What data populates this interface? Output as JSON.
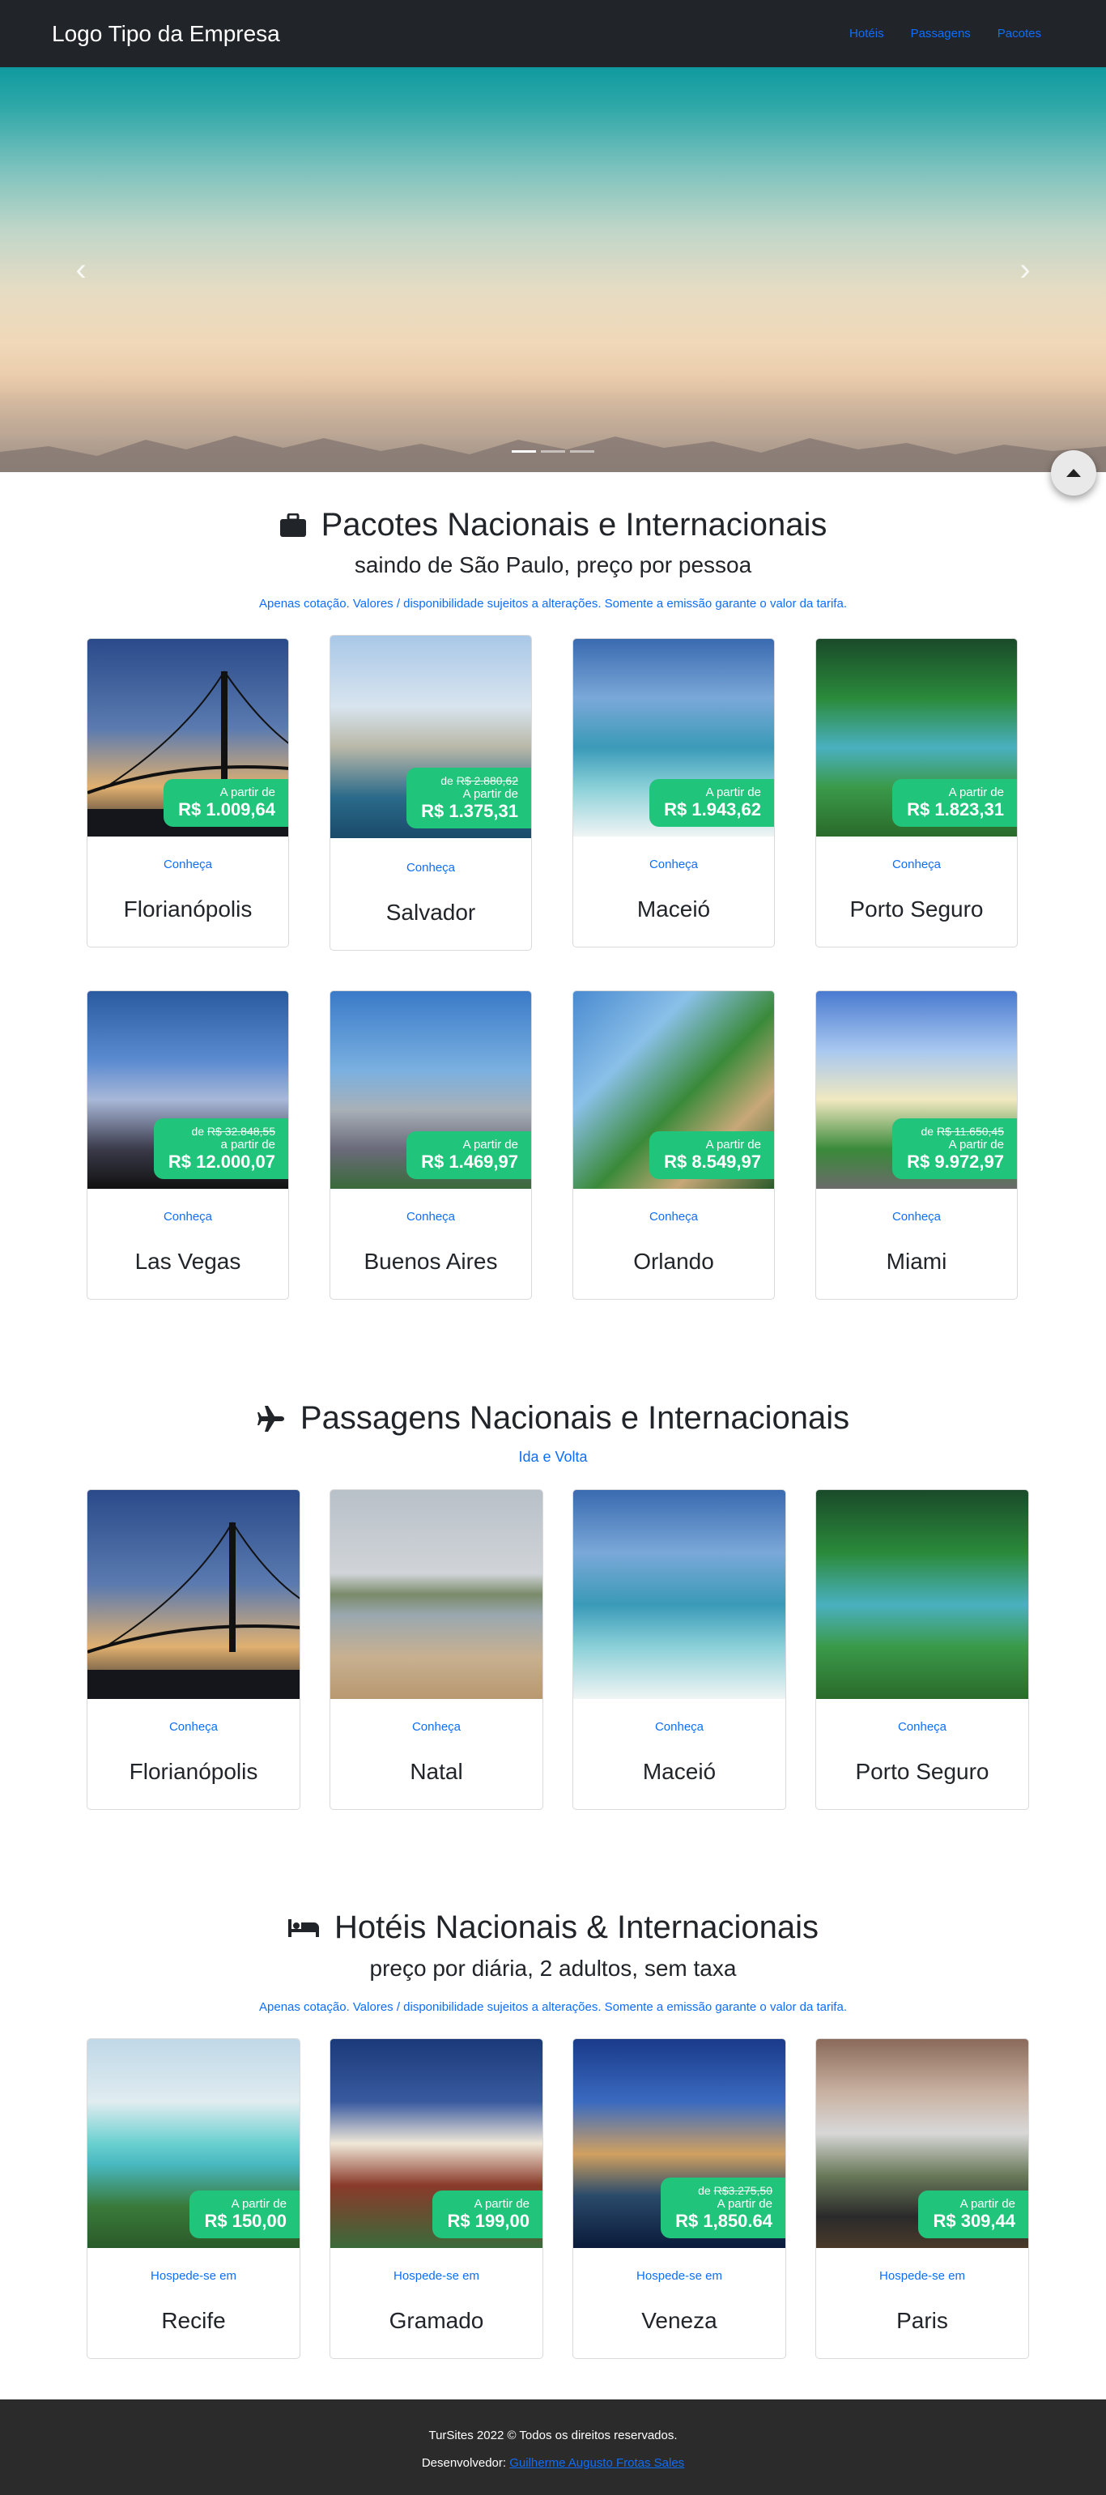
{
  "navbar": {
    "brand": "Logo Tipo da Empresa",
    "links": [
      "Hotéis",
      "Passagens",
      "Pacotes"
    ]
  },
  "carousel": {
    "prev": "‹",
    "next": "›",
    "slides": 3,
    "active": 0
  },
  "packages": {
    "title": "Pacotes Nacionais e Internacionais",
    "icon": "briefcase-icon",
    "subtitle": "saindo de São Paulo, preço por pessoa",
    "note": "Apenas cotação. Valores / disponibilidade sujeitos a alterações. Somente a emissão garante o valor da tarifa.",
    "cards": [
      {
        "city": "Florianópolis",
        "cta": "Conheça",
        "old_prefix": "",
        "old_price": "",
        "from": "A partir de",
        "price": "R$ 1.009,64"
      },
      {
        "city": "Salvador",
        "cta": "Conheça",
        "old_prefix": "de",
        "old_price": "R$ 2.880,62",
        "from": "A partir de",
        "price": "R$ 1.375,31"
      },
      {
        "city": "Maceió",
        "cta": "Conheça",
        "old_prefix": "",
        "old_price": "",
        "from": "A partir de",
        "price": "R$ 1.943,62"
      },
      {
        "city": "Porto Seguro",
        "cta": "Conheça",
        "old_prefix": "",
        "old_price": "",
        "from": "A partir de",
        "price": "R$ 1.823,31"
      },
      {
        "city": "Las Vegas",
        "cta": "Conheça",
        "old_prefix": "de",
        "old_price": "R$ 32.848,55",
        "from": "a partir de",
        "price": "R$ 12.000,07"
      },
      {
        "city": "Buenos Aires",
        "cta": "Conheça",
        "old_prefix": "",
        "old_price": "",
        "from": "A partir de",
        "price": "R$ 1.469,97"
      },
      {
        "city": "Orlando",
        "cta": "Conheça",
        "old_prefix": "",
        "old_price": "",
        "from": "A partir de",
        "price": "R$ 8.549,97"
      },
      {
        "city": "Miami",
        "cta": "Conheça",
        "old_prefix": "de",
        "old_price": "R$ 11.650,45",
        "from": "A partir de",
        "price": "R$ 9.972,97"
      }
    ]
  },
  "flights": {
    "title": "Passagens Nacionais e Internacionais",
    "icon": "airplane-icon",
    "subtitle": "Ida e Volta",
    "cards": [
      {
        "city": "Florianópolis",
        "cta": "Conheça"
      },
      {
        "city": "Natal",
        "cta": "Conheça"
      },
      {
        "city": "Maceió",
        "cta": "Conheça"
      },
      {
        "city": "Porto Seguro",
        "cta": "Conheça"
      }
    ]
  },
  "hotels": {
    "title": "Hotéis Nacionais & Internacionais",
    "icon": "bed-icon",
    "subtitle": "preço por diária, 2 adultos, sem taxa",
    "note": "Apenas cotação. Valores / disponibilidade sujeitos a alterações. Somente a emissão garante o valor da tarifa.",
    "cards": [
      {
        "city": "Recife",
        "cta": "Hospede-se em",
        "old_prefix": "",
        "old_price": "",
        "from": "A partir de",
        "price": "R$ 150,00"
      },
      {
        "city": "Gramado",
        "cta": "Hospede-se em",
        "old_prefix": "",
        "old_price": "",
        "from": "A partir de",
        "price": "R$ 199,00"
      },
      {
        "city": "Veneza",
        "cta": "Hospede-se em",
        "old_prefix": "de",
        "old_price": "R$3.275,50",
        "from": "A partir de",
        "price": "R$ 1,850.64"
      },
      {
        "city": "Paris",
        "cta": "Hospede-se em",
        "old_prefix": "",
        "old_price": "",
        "from": "A partir de",
        "price": "R$ 309,44"
      }
    ]
  },
  "footer": {
    "copyright": "TurSites 2022 © Todos os direitos reservados.",
    "dev_label": "Desenvolvedor:",
    "dev_name": "Guilherme Augusto Frotas Sales"
  },
  "colors": {
    "navbar": "#212529",
    "accent": "#0d6efd",
    "price_badge": "#20c47a",
    "footer": "#2b2b2b"
  }
}
